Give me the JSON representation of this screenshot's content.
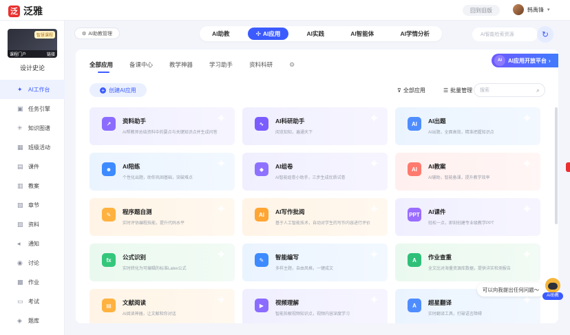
{
  "app": {
    "logo_mark": "泛",
    "logo_text": "泛雅"
  },
  "header": {
    "back_old": "回到旧版",
    "user_name": "韩禹锋"
  },
  "sidebar": {
    "course_tag": "智慧课程",
    "course_portal": "课程门户",
    "course_link": "链接",
    "course_title": "设计史论",
    "items": [
      {
        "label": "AI工作台",
        "icon": "ai-workbench-icon",
        "active": true
      },
      {
        "label": "任务引擎",
        "icon": "task-engine-icon"
      },
      {
        "label": "知识图谱",
        "icon": "knowledge-graph-icon"
      },
      {
        "label": "班级活动",
        "icon": "class-activity-icon"
      },
      {
        "label": "课件",
        "icon": "courseware-icon"
      },
      {
        "label": "教案",
        "icon": "lesson-plan-icon"
      },
      {
        "label": "章节",
        "icon": "chapter-icon"
      },
      {
        "label": "资料",
        "icon": "materials-icon"
      },
      {
        "label": "通知",
        "icon": "notice-icon"
      },
      {
        "label": "讨论",
        "icon": "discussion-icon"
      },
      {
        "label": "作业",
        "icon": "homework-icon"
      },
      {
        "label": "考试",
        "icon": "exam-icon"
      },
      {
        "label": "题库",
        "icon": "question-bank-icon"
      }
    ]
  },
  "toolbar": {
    "ai_manage": "AI助教管理",
    "top_tabs": [
      "AI助教",
      "AI应用",
      "AI实践",
      "AI智能体",
      "AI学情分析"
    ],
    "active_top_tab": "AI应用",
    "search_placeholder": "AI智能检索资源"
  },
  "panel": {
    "category_tabs": [
      "全部应用",
      "备课中心",
      "教学神器",
      "学习助手",
      "资料科研"
    ],
    "active_category": "全部应用",
    "open_platform": "AI应用开放平台",
    "create_button": "创建AI应用",
    "filter_all": "全部应用",
    "batch_manage": "批量管理",
    "search_placeholder": "搜索"
  },
  "cards": [
    {
      "title": "资料助手",
      "desc": "AI帮教师总结资料中的要点与关键知识点并生成问答",
      "color": "purple",
      "icon_bg": "#8b6cff",
      "icon": "trend-icon"
    },
    {
      "title": "AI科研助手",
      "desc": "阅览知知，遍通天下",
      "color": "purple",
      "icon_bg": "#7a5cff",
      "icon": "research-icon"
    },
    {
      "title": "AI出题",
      "desc": "AI出题，全面高效，精准把握知识点",
      "color": "blue",
      "icon_bg": "#4f8dff",
      "icon": "quiz-icon"
    },
    {
      "title": "AI陪练",
      "desc": "个性化出题，助你巩固基础，突破难点",
      "color": "blue",
      "icon_bg": "#3d8bff",
      "icon": "practice-icon"
    },
    {
      "title": "AI组卷",
      "desc": "AI智能组卷小助手，三步生成优质试卷",
      "color": "purple",
      "icon_bg": "#8e72ff",
      "icon": "paper-icon"
    },
    {
      "title": "AI教案",
      "desc": "AI辅助，智能备课，提升教学效率",
      "color": "red",
      "icon_bg": "#ff7a6e",
      "icon": "lesson-icon"
    },
    {
      "title": "程序题自测",
      "desc": "实时评估编程技能，提升代码水平",
      "color": "orange",
      "icon_bg": "#ffb23f",
      "icon": "code-icon"
    },
    {
      "title": "AI写作批阅",
      "desc": "基于人工智能技术，自动对学生的写作内容进行评价",
      "color": "orange",
      "icon_bg": "#ffa534",
      "icon": "writing-icon"
    },
    {
      "title": "AI课件",
      "desc": "轻松一点，即刻创建专业级教学PPT",
      "color": "purple",
      "icon_bg": "#9a6cff",
      "icon": "ppt-icon"
    },
    {
      "title": "公式识别",
      "desc": "实时转化为可编辑的标准Latex公式",
      "color": "green",
      "icon_bg": "#34c77b",
      "icon": "formula-icon"
    },
    {
      "title": "智能编写",
      "desc": "多样主题，自由风格，一键成文",
      "color": "blue",
      "icon_bg": "#3d8bff",
      "icon": "edit-icon"
    },
    {
      "title": "作业查重",
      "desc": "全文比对海量资源库数据，提供详实检测报告",
      "color": "green",
      "icon_bg": "#2fbf79",
      "icon": "check-icon"
    },
    {
      "title": "文献阅读",
      "desc": "AI阅读神器，让文献和你对话",
      "color": "orange",
      "icon_bg": "#ffb23f",
      "icon": "reading-icon"
    },
    {
      "title": "视频理解",
      "desc": "智能拆解视频知识点，视频内容深度学习",
      "color": "purple",
      "icon_bg": "#8b6cff",
      "icon": "video-icon"
    },
    {
      "title": "超星翻译",
      "desc": "实时翻译工具，打破语言障碍",
      "color": "blue",
      "icon_bg": "#4f8dff",
      "icon": "translate-icon"
    }
  ],
  "assistant": {
    "bubble": "可以向我提出任何问题～",
    "label": "AI助教"
  }
}
